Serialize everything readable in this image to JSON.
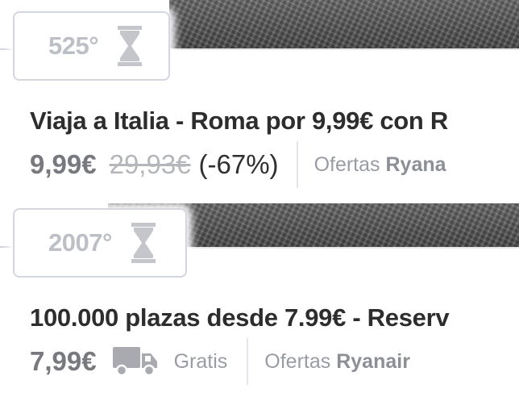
{
  "deals": [
    {
      "temperature": "525°",
      "title": "Viaja a Italia - Roma por 9,99€ con R",
      "price": "9,99€",
      "old_price": "29,93€",
      "discount": "(-67%)",
      "store_prefix": "Ofertas",
      "store_name": "Ryana"
    },
    {
      "temperature": "2007°",
      "title": "100.000 plazas desde 7.99€ - Reserv",
      "price": "7,99€",
      "shipping": "Gratis",
      "store_prefix": "Ofertas",
      "store_name": "Ryanair"
    }
  ],
  "icons": {
    "timer": "hourglass-icon",
    "shipping": "truck-icon"
  },
  "colors": {
    "badge_border": "#d4d7de",
    "temperature_text": "#bdbfc6",
    "price_text": "#77797f",
    "title_text": "#2d2d2d"
  }
}
